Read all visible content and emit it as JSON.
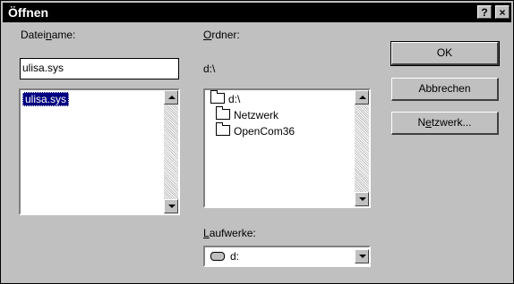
{
  "window": {
    "title": "Öffnen",
    "help_glyph": "?",
    "close_glyph": "×"
  },
  "filename": {
    "label_pre": "Datei",
    "label_u": "n",
    "label_post": "ame:",
    "value": "ulisa.sys",
    "list": [
      "ulisa.sys"
    ]
  },
  "folders": {
    "label_pre": "",
    "label_u": "O",
    "label_post": "rdner:",
    "path": "d:\\",
    "tree": [
      {
        "name": "d:\\",
        "icon": "open-folder-icon"
      },
      {
        "name": "Netzwerk",
        "icon": "folder-icon"
      },
      {
        "name": "OpenCom36",
        "icon": "folder-icon"
      }
    ]
  },
  "drives": {
    "label_pre": "",
    "label_u": "L",
    "label_post": "aufwerke:",
    "selected": "d:",
    "icon": "drive-icon"
  },
  "buttons": {
    "ok": "OK",
    "cancel": "Abbrechen",
    "network_pre": "N",
    "network_u": "e",
    "network_post": "tzwerk..."
  }
}
